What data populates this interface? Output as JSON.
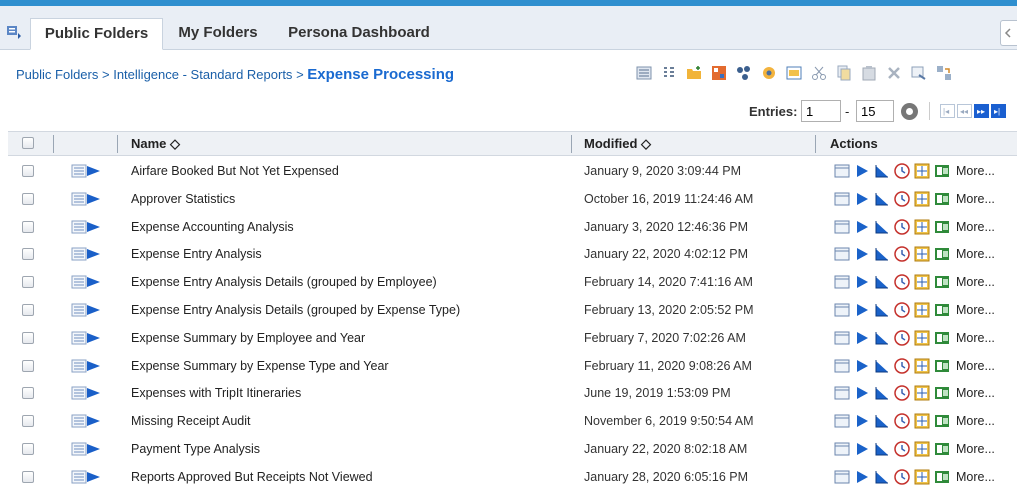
{
  "tabs": [
    {
      "label": "Public Folders",
      "active": true
    },
    {
      "label": "My Folders",
      "active": false
    },
    {
      "label": "Persona Dashboard",
      "active": false
    }
  ],
  "breadcrumb": {
    "items": [
      "Public Folders",
      "Intelligence - Standard Reports"
    ],
    "separator": ">",
    "current": "Expense Processing"
  },
  "toolbar_icons": [
    "list-view-icon",
    "details-view-icon",
    "new-folder-icon",
    "new-report-icon",
    "share-icon",
    "favorites-icon",
    "properties-icon",
    "cut-icon",
    "copy-icon",
    "paste-icon",
    "delete-icon",
    "export-icon",
    "import-icon"
  ],
  "entries": {
    "label": "Entries:",
    "from": "1",
    "dash": "-",
    "to": "15"
  },
  "pager": [
    "first-page-icon",
    "prev-page-icon",
    "next-page-icon",
    "last-page-icon"
  ],
  "columns": {
    "name": "Name ◇",
    "modified": "Modified ◇",
    "actions": "Actions"
  },
  "actions": {
    "icons": [
      "view-icon",
      "run-icon",
      "chart-icon",
      "schedule-icon",
      "grid-icon",
      "excel-icon"
    ],
    "more_label": "More..."
  },
  "rows": [
    {
      "name": "Airfare Booked But Not Yet Expensed",
      "modified": "January 9, 2020 3:09:44 PM"
    },
    {
      "name": "Approver Statistics",
      "modified": "October 16, 2019 11:24:46 AM"
    },
    {
      "name": "Expense Accounting Analysis",
      "modified": "January 3, 2020 12:46:36 PM"
    },
    {
      "name": "Expense Entry Analysis",
      "modified": "January 22, 2020 4:02:12 PM"
    },
    {
      "name": "Expense Entry Analysis Details (grouped by Employee)",
      "modified": "February 14, 2020 7:41:16 AM"
    },
    {
      "name": "Expense Entry Analysis Details (grouped by Expense Type)",
      "modified": "February 13, 2020 2:05:52 PM"
    },
    {
      "name": "Expense Summary by Employee and Year",
      "modified": "February 7, 2020 7:02:26 AM"
    },
    {
      "name": "Expense Summary by Expense Type and Year",
      "modified": "February 11, 2020 9:08:26 AM"
    },
    {
      "name": "Expenses with TripIt Itineraries",
      "modified": "June 19, 2019 1:53:09 PM"
    },
    {
      "name": "Missing Receipt Audit",
      "modified": "November 6, 2019 9:50:54 AM"
    },
    {
      "name": "Payment Type Analysis",
      "modified": "January 22, 2020 8:02:18 AM"
    },
    {
      "name": "Reports Approved But Receipts Not Viewed",
      "modified": "January 28, 2020 6:05:16 PM"
    }
  ],
  "colors": {
    "accent": "#2f8fcf",
    "link": "#1a5fa8",
    "current": "#1a6ad0",
    "header_bg": "#eef1f5"
  }
}
